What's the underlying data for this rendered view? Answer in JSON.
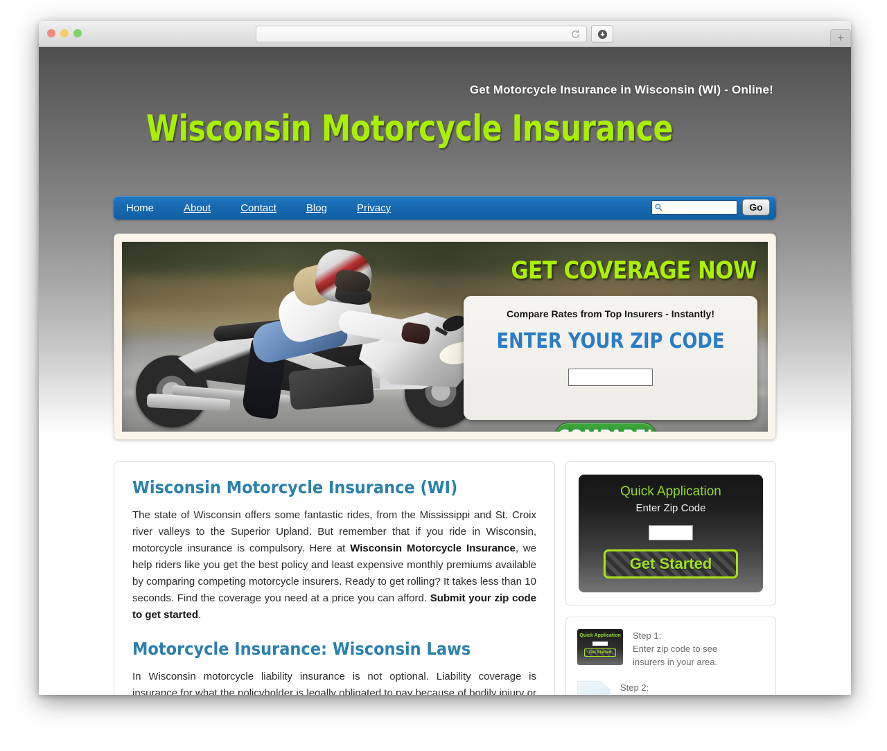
{
  "browser": {
    "address_value": "",
    "address_placeholder": "",
    "reload_icon": "reload-icon",
    "download_icon": "download-icon",
    "new_tab_label": "+"
  },
  "header": {
    "tagline": "Get Motorcycle Insurance in Wisconsin (WI) - Online!",
    "title": "Wisconsin Motorcycle Insurance",
    "title_color": "#a8f000"
  },
  "nav": {
    "items": [
      {
        "label": "Home",
        "current": true
      },
      {
        "label": "About",
        "current": false
      },
      {
        "label": "Contact",
        "current": false
      },
      {
        "label": "Blog",
        "current": false
      },
      {
        "label": "Privacy",
        "current": false
      }
    ],
    "search_icon": "search-icon",
    "search_value": "",
    "search_placeholder": "",
    "go_label": "Go",
    "bar_color": "#1767ae"
  },
  "hero": {
    "image_alt": "woman riding silver sport motorcycle",
    "heading": "GET COVERAGE NOW",
    "panel_subtitle": "Compare Rates from Top Insurers - Instantly!",
    "panel_title": "ENTER YOUR ZIP CODE",
    "zip_value": "",
    "zip_placeholder": "",
    "compare_label": "COMPARE!",
    "compare_color": "#27922b"
  },
  "main": {
    "sections": [
      {
        "title": "Wisconsin Motorcycle Insurance (WI)",
        "paragraph_parts": [
          {
            "text": "The state of Wisconsin offers some fantastic rides, from the Mississippi and St. Croix river valleys to the Superior Upland. But remember that if you ride in Wisconsin, motorcycle insurance is compulsory. Here at ",
            "bold": false
          },
          {
            "text": "Wisconsin Motorcycle Insurance",
            "bold": true
          },
          {
            "text": ", we help riders like you get the best policy and least expensive monthly premiums available by comparing competing motorcycle insurers. Ready to get rolling? It takes less than 10 seconds. Find the coverage you need at a price you can afford. ",
            "bold": false
          },
          {
            "text": "Submit your zip code to get started",
            "bold": true
          },
          {
            "text": ".",
            "bold": false
          }
        ]
      },
      {
        "title": "Motorcycle Insurance: Wisconsin Laws",
        "paragraph_parts": [
          {
            "text": "In Wisconsin motorcycle liability insurance is not optional. Liability coverage is insurance for what the policyholder is legally obligated to pay because of bodily injury or property damage caused to another person. The state",
            "bold": false
          }
        ]
      }
    ],
    "heading_color": "#2b80ab"
  },
  "sidebar": {
    "quick_app": {
      "title": "Quick Application",
      "subtitle": "Enter Zip Code",
      "zip_value": "",
      "zip_placeholder": "",
      "button_label": "Get Started",
      "accent_color": "#9fe021"
    },
    "steps": [
      {
        "icon": "quick-application-thumbnail-icon",
        "label": "Step 1:",
        "line1": "Enter zip code to see",
        "line2": "insurers in your area.",
        "thumb_title": "Quick Application",
        "thumb_button": "Get Started"
      },
      {
        "icon": "document-icon",
        "label": "Step 2:",
        "line1": "",
        "line2": ""
      }
    ]
  }
}
